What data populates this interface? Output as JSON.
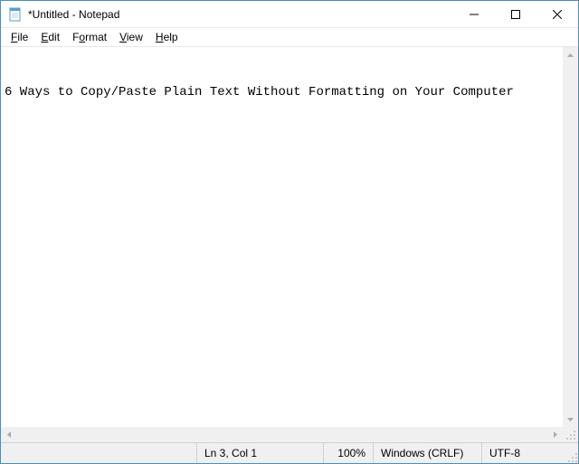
{
  "window": {
    "title": "*Untitled - Notepad"
  },
  "menu": {
    "file": {
      "label": "File",
      "accel": "F"
    },
    "edit": {
      "label": "Edit",
      "accel": "E"
    },
    "format": {
      "label": "Format",
      "accel": "o"
    },
    "view": {
      "label": "View",
      "accel": "V"
    },
    "help": {
      "label": "Help",
      "accel": "H"
    }
  },
  "editor": {
    "content": "\n\n6 Ways to Copy/Paste Plain Text Without Formatting on Your Computer"
  },
  "status": {
    "lncol": "Ln 3, Col 1",
    "zoom": "100%",
    "eol": "Windows (CRLF)",
    "encoding": "UTF-8"
  }
}
